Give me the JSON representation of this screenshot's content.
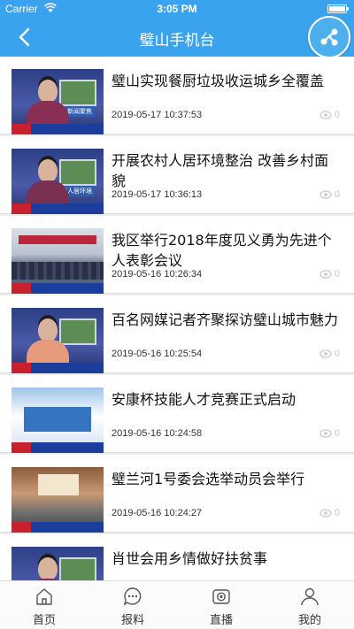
{
  "status_bar": {
    "carrier": "Carrier",
    "time": "3:05 PM",
    "battery_level": 1.0
  },
  "nav": {
    "title": "璧山手机台",
    "back_icon": "chevron-left-icon",
    "share_icon": "share-icon"
  },
  "news": [
    {
      "title": "璧山实现餐厨垃圾收运城乡全覆盖",
      "date": "2019-05-17 10:37:53",
      "views": "0",
      "thumb": "studio",
      "caption": "新闻聚焦"
    },
    {
      "title": "开展农村人居环境整治 改善乡村面貌",
      "date": "2019-05-17 10:36:13",
      "views": "0",
      "thumb": "studio",
      "caption": "农村人居环境"
    },
    {
      "title": "我区举行2018年度见义勇为先进个人表彰会议",
      "date": "2019-05-16 10:26:34",
      "views": "0",
      "thumb": "meeting"
    },
    {
      "title": "百名网媒记者齐聚探访璧山城市魅力",
      "date": "2019-05-16 10:25:54",
      "views": "0",
      "thumb": "studio",
      "caption": ""
    },
    {
      "title": "安康杯技能人才竞赛正式启动",
      "date": "2019-05-16 10:24:58",
      "views": "0",
      "thumb": "blue-bg"
    },
    {
      "title": "璧兰河1号委会选举动员会举行",
      "date": "2019-05-16 10:24:27",
      "views": "0",
      "thumb": "hall"
    },
    {
      "title": "肖世会用乡情做好扶贫事",
      "date": "",
      "views": "",
      "thumb": "studio"
    }
  ],
  "tabs": [
    {
      "label": "首页",
      "icon": "home-icon"
    },
    {
      "label": "报料",
      "icon": "chat-icon"
    },
    {
      "label": "直播",
      "icon": "camera-icon"
    },
    {
      "label": "我的",
      "icon": "user-icon"
    }
  ],
  "colors": {
    "accent": "#3aa3f0"
  }
}
